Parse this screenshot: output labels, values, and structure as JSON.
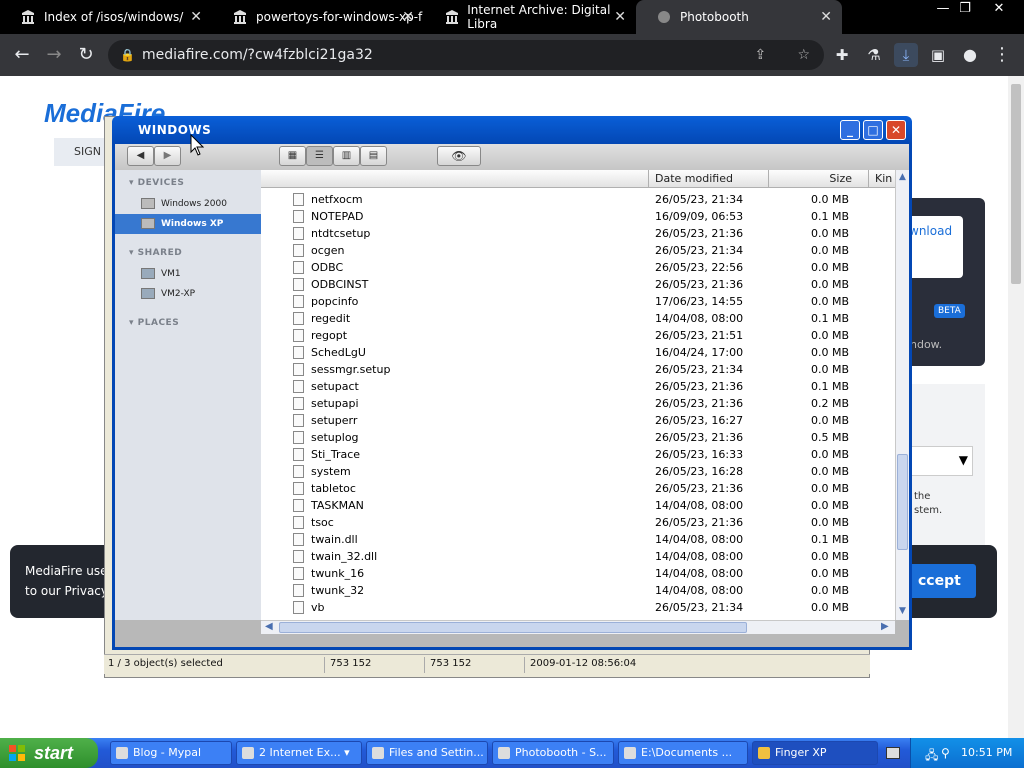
{
  "browser": {
    "tabs": [
      {
        "label": "Index of /isos/windows/",
        "icon": "archive-icon"
      },
      {
        "label": "powertoys-for-windows-xp-f",
        "icon": "archive-icon"
      },
      {
        "label": "Internet Archive: Digital Libra",
        "icon": "archive-icon"
      },
      {
        "label": "Photobooth",
        "icon": "globe-icon",
        "active": true
      }
    ],
    "url": "mediafire.com/?cw4fzblci21ga32"
  },
  "webpage": {
    "logo": "MediaFire",
    "signin": "SIGN U",
    "download_link": "wnload",
    "beta": "BETA",
    "panel_text": "ndow.",
    "grey_text_1": "the",
    "grey_text_2": "stem.",
    "cookie_line1": "MediaFire use",
    "cookie_line2": "to our Privacy",
    "accept": "ccept"
  },
  "finder": {
    "title": "WINDOWS",
    "sidebar": {
      "devices_header": "DEVICES",
      "devices": [
        {
          "label": "Windows 2000"
        },
        {
          "label": "Windows XP",
          "selected": true
        }
      ],
      "shared_header": "SHARED",
      "shared": [
        {
          "label": "VM1"
        },
        {
          "label": "VM2-XP"
        }
      ],
      "places_header": "PLACES"
    },
    "columns": {
      "date": "Date modified",
      "size": "Size",
      "kind": "Kin"
    },
    "files": [
      {
        "name": "netfxocm",
        "date": "26/05/23, 21:34",
        "size": "0.0 MB"
      },
      {
        "name": "NOTEPAD",
        "date": "16/09/09, 06:53",
        "size": "0.1 MB"
      },
      {
        "name": "ntdtcsetup",
        "date": "26/05/23, 21:36",
        "size": "0.0 MB"
      },
      {
        "name": "ocgen",
        "date": "26/05/23, 21:34",
        "size": "0.0 MB"
      },
      {
        "name": "ODBC",
        "date": "26/05/23, 22:56",
        "size": "0.0 MB"
      },
      {
        "name": "ODBCINST",
        "date": "26/05/23, 21:36",
        "size": "0.0 MB"
      },
      {
        "name": "popcinfo",
        "date": "17/06/23, 14:55",
        "size": "0.0 MB"
      },
      {
        "name": "regedit",
        "date": "14/04/08, 08:00",
        "size": "0.1 MB"
      },
      {
        "name": "regopt",
        "date": "26/05/23, 21:51",
        "size": "0.0 MB"
      },
      {
        "name": "SchedLgU",
        "date": "16/04/24, 17:00",
        "size": "0.0 MB"
      },
      {
        "name": "sessmgr.setup",
        "date": "26/05/23, 21:34",
        "size": "0.0 MB"
      },
      {
        "name": "setupact",
        "date": "26/05/23, 21:36",
        "size": "0.1 MB"
      },
      {
        "name": "setupapi",
        "date": "26/05/23, 21:36",
        "size": "0.2 MB"
      },
      {
        "name": "setuperr",
        "date": "26/05/23, 16:27",
        "size": "0.0 MB"
      },
      {
        "name": "setuplog",
        "date": "26/05/23, 21:36",
        "size": "0.5 MB"
      },
      {
        "name": "Sti_Trace",
        "date": "26/05/23, 16:33",
        "size": "0.0 MB"
      },
      {
        "name": "system",
        "date": "26/05/23, 16:28",
        "size": "0.0 MB"
      },
      {
        "name": "tabletoc",
        "date": "26/05/23, 21:36",
        "size": "0.0 MB"
      },
      {
        "name": "TASKMAN",
        "date": "14/04/08, 08:00",
        "size": "0.0 MB"
      },
      {
        "name": "tsoc",
        "date": "26/05/23, 21:36",
        "size": "0.0 MB"
      },
      {
        "name": "twain.dll",
        "date": "14/04/08, 08:00",
        "size": "0.1 MB"
      },
      {
        "name": "twain_32.dll",
        "date": "14/04/08, 08:00",
        "size": "0.0 MB"
      },
      {
        "name": "twunk_16",
        "date": "14/04/08, 08:00",
        "size": "0.0 MB"
      },
      {
        "name": "twunk_32",
        "date": "14/04/08, 08:00",
        "size": "0.0 MB"
      },
      {
        "name": "vb",
        "date": "26/05/23, 21:34",
        "size": "0.0 MB"
      }
    ]
  },
  "statusbar": {
    "selection": "1 / 3 object(s) selected",
    "value1": "753 152",
    "value2": "753 152",
    "datetime": "2009-01-12 08:56:04"
  },
  "taskbar": {
    "start": "start",
    "tasks": [
      {
        "label": "Blog - Mypal"
      },
      {
        "label": "2 Internet Ex..."
      },
      {
        "label": "Files and Settin..."
      },
      {
        "label": "Photobooth - S..."
      },
      {
        "label": "E:\\Documents ..."
      },
      {
        "label": "Finger XP",
        "active": true
      }
    ],
    "clock": "10:51 PM"
  }
}
